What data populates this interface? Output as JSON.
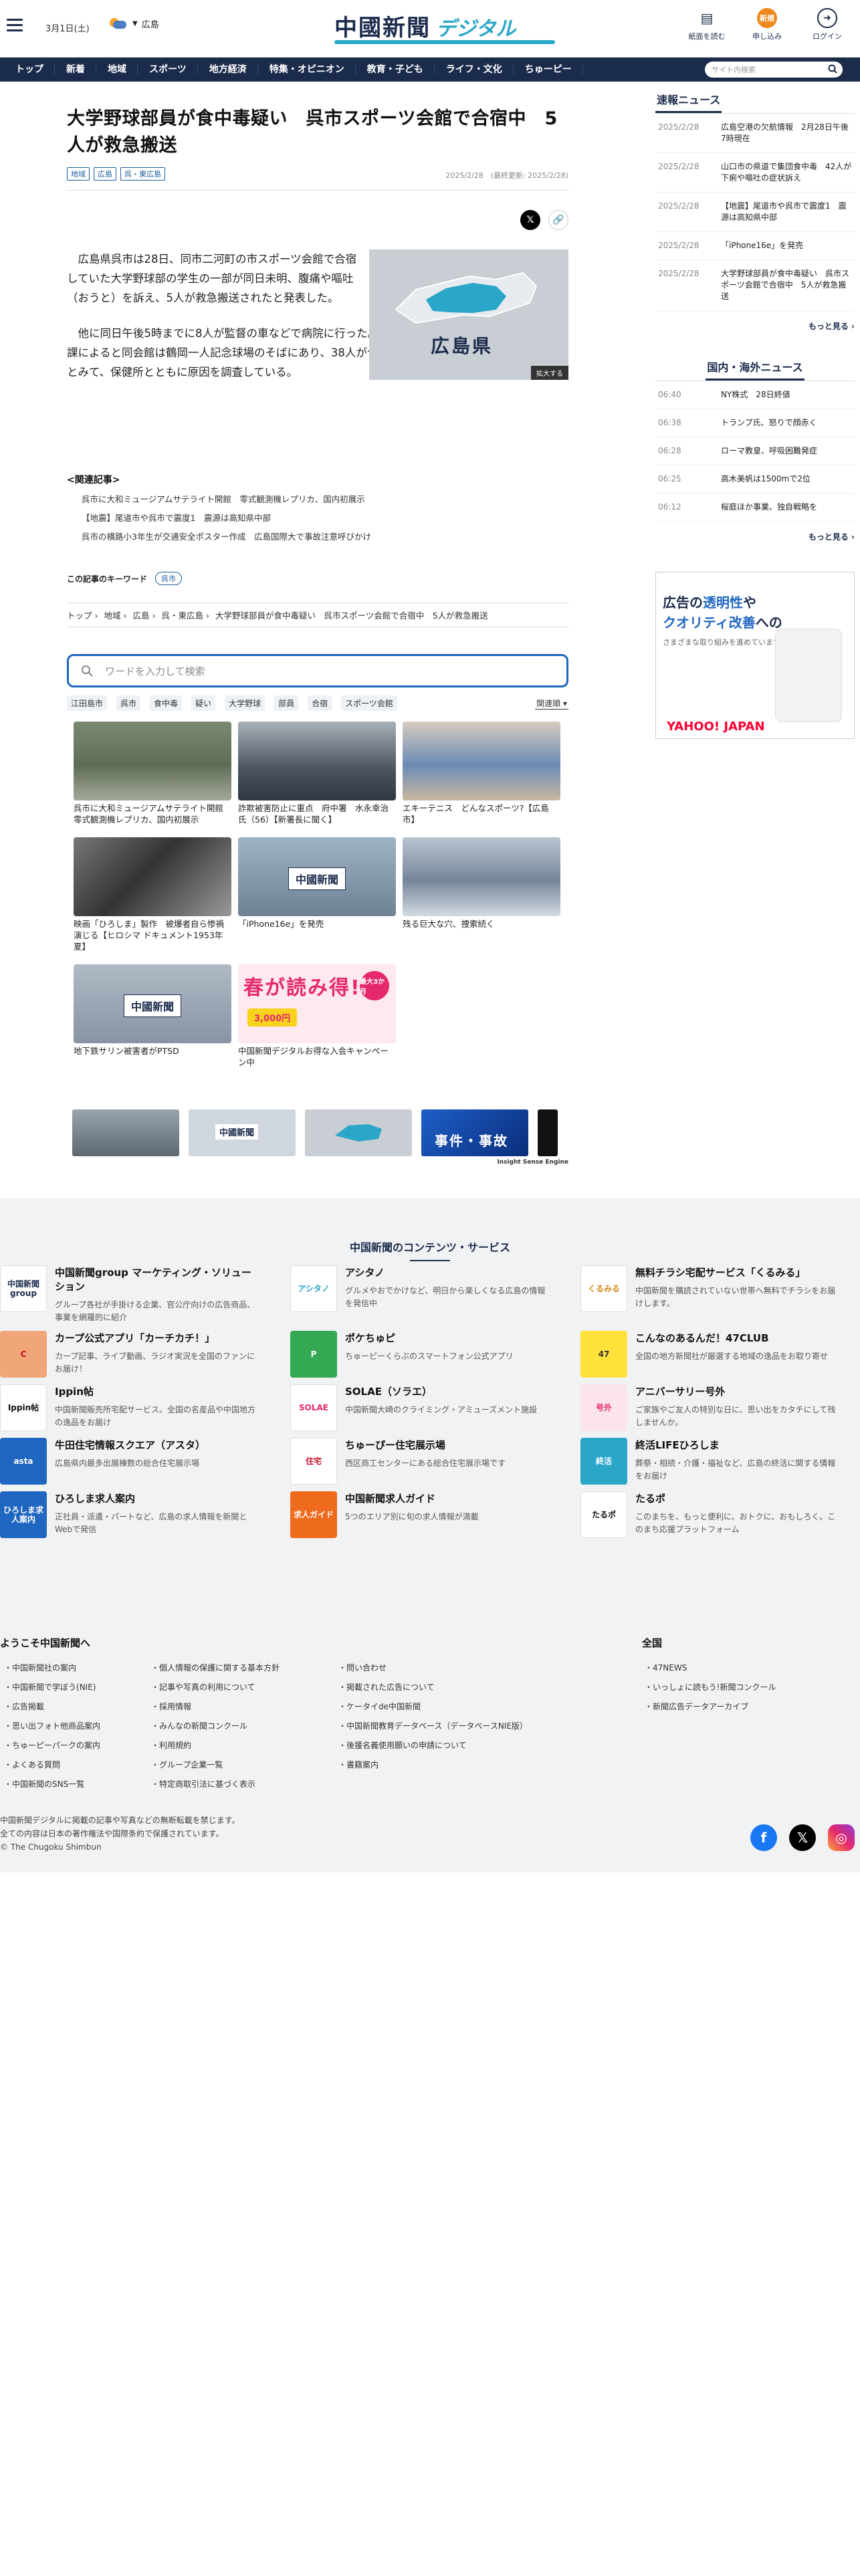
{
  "header": {
    "date": "3月1日(土)",
    "region": "広島",
    "logo_main": "中國新聞",
    "logo_sub": "デジタル",
    "buttons": [
      {
        "label": "紙面を読む"
      },
      {
        "label": "申し込み"
      },
      {
        "label": "ログイン"
      }
    ]
  },
  "nav": {
    "items": [
      "トップ",
      "新着",
      "地域",
      "スポーツ",
      "地方経済",
      "特集・オピニオン",
      "教育・子ども",
      "ライフ・文化",
      "ちゅーピー"
    ],
    "search_placeholder": "サイト内検索"
  },
  "article": {
    "title": "大学野球部員が食中毒疑い　呉市スポーツ会館で合宿中　5人が救急搬送",
    "tags": [
      "地域",
      "広島",
      "呉・東広島"
    ],
    "dates": "2025/2/28　(最終更新: 2025/2/28)",
    "figure_caption": "広島県",
    "zoom_label": "拡大する",
    "p1": "広島県呉市は28日、同市二河町の市スポーツ会館で合宿していた大学野球部の学生の一部が同日未明、腹痛や嘔吐（おうと）を訴え、5人が救急搬送されたと発表した。",
    "p2": "他に同日午後5時までに8人が監督の車などで病院に行った。1人は入院している。市スポーツ振興課によると同会館は鶴岡一人記念球場のそばにあり、38人が合宿していた。市は食中毒の疑いがあるとみて、保健所とともに原因を調査している。"
  },
  "related": {
    "heading": "<関連記事>",
    "items": [
      "呉市に大和ミュージアムサテライト開館　零式観測機レプリカ、国内初展示",
      "【地震】尾道市や呉市で震度1　震源は高知県中部",
      "呉市の横路小3年生が交通安全ポスター作成　広島国際大で事故注意呼びかけ"
    ]
  },
  "keywords": {
    "label": "この記事のキーワード",
    "items": [
      "呉市"
    ]
  },
  "breadcrumb": [
    "トップ",
    "›",
    "地域",
    "›",
    "広島",
    "›",
    "呉・東広島",
    "›",
    "大学野球部員が食中毒疑い　呉市スポーツ会館で合宿中　5人が救急搬送"
  ],
  "search": {
    "placeholder": "ワードを入力して検索",
    "tags": [
      "江田島市",
      "呉市",
      "食中毒",
      "疑い",
      "大学野球",
      "部員",
      "合宿",
      "スポーツ会館"
    ],
    "sort": "関連順"
  },
  "cards": [
    {
      "title": "呉市に大和ミュージアムサテライト開館　零式観測機レプリカ、国内初展示"
    },
    {
      "title": "詐欺被害防止に重点　府中署　水永幸治氏（56）【新署長に聞く】"
    },
    {
      "title": "エキーテニス　どんなスポーツ?【広島市】"
    },
    {
      "title": "映画「ひろしま」製作　被爆者自ら惨禍演じる【ヒロシマ ドキュメント1953年夏】"
    },
    {
      "title": "「iPhone16e」を発売",
      "logo": "中國新聞"
    },
    {
      "title": "残る巨大な穴、捜索続く"
    },
    {
      "title": "地下鉄サリン被害者がPTSD",
      "logo": "中國新聞"
    },
    {
      "title": "中国新聞デジタルお得な入会キャンペーン中",
      "promo": "春が読み得!",
      "promo2": "3,000円",
      "promo3": "最大3か月"
    }
  ],
  "ad_label": "広告",
  "strip": {
    "logo": "中國新聞",
    "banner": "事件・事故",
    "credit": "Insight Sense Engine"
  },
  "sidebar": {
    "flash_title": "速報ニュース",
    "flash": [
      {
        "date": "2025/2/28",
        "title": "広島空港の欠航情報　2月28日午後7時現在"
      },
      {
        "date": "2025/2/28",
        "title": "山口市の県道で集団食中毒　42人が下痢や嘔吐の症状訴え"
      },
      {
        "date": "2025/2/28",
        "title": "【地震】尾道市や呉市で震度1　震源は高知県中部"
      },
      {
        "date": "2025/2/28",
        "title": "「iPhone16e」を発売"
      },
      {
        "date": "2025/2/28",
        "title": "大学野球部員が食中毒疑い　呉市スポーツ会館で合宿中　5人が救急搬送"
      }
    ],
    "more": "もっと見る ›",
    "world_title": "国内・海外ニュース",
    "world": [
      {
        "date": "06:40",
        "title": "NY株式　28日終値"
      },
      {
        "date": "06:38",
        "title": "トランプ氏、怒りで顔赤く"
      },
      {
        "date": "06:28",
        "title": "ローマ教皇、呼吸困難発症"
      },
      {
        "date": "06:25",
        "title": "高木美帆は1500mで2位"
      },
      {
        "date": "06:12",
        "title": "桜庭ほか事業、独自戦略を"
      }
    ],
    "ad_h1": "広告の",
    "ad_h2": "透明性",
    "ad_h3": "や",
    "ad_h4": "クオリティ改善",
    "ad_h5": "への",
    "ad_sub": "さまざまな取り組みを進めています。",
    "ad_brand": "YAHOO! JAPAN"
  },
  "services": {
    "heading": "中国新聞のコンテンツ・サービス",
    "items": [
      {
        "name": "中国新聞group マーケティング・ソリューション",
        "desc": "グループ各社が手掛ける企業、官公庁向けの広告商品、事業を網羅的に紹介",
        "logo": "中国新聞group",
        "color": "#ffffff",
        "fg": "#1b2b4b"
      },
      {
        "name": "アシタノ",
        "desc": "グルメやおでかけなど、明日から楽しくなる広島の情報を発信中",
        "logo": "アシタノ",
        "color": "#ffffff",
        "fg": "#2aa6c9"
      },
      {
        "name": "無料チラシ宅配サービス「くるみる」",
        "desc": "中国新聞を購読されていない世帯へ無料でチラシをお届けします。",
        "logo": "くるみる",
        "color": "#ffffff",
        "fg": "#d28b1b"
      },
      {
        "name": "カープ公式アプリ「カーチカチ！」",
        "desc": "カープ記事、ライブ動画、ラジオ実況を全国のファンにお届け！",
        "logo": "C",
        "color": "#f0a679",
        "fg": "#c8102e"
      },
      {
        "name": "ポケちゅピ",
        "desc": "ちゅーピーくらぶのスマートフォン公式アプリ",
        "logo": "P",
        "color": "#34a853",
        "fg": "#ffffff"
      },
      {
        "name": "こんなのあるんだ！47CLUB",
        "desc": "全国の地方新聞社が厳選する地域の逸品をお取り寄せ",
        "logo": "47",
        "color": "#ffe23a",
        "fg": "#333"
      },
      {
        "name": "Ippin帖",
        "desc": "中国新聞販売所宅配サービス。全国の名産品や中国地方の逸品をお届け",
        "logo": "Ippin帖",
        "color": "#ffffff",
        "fg": "#111"
      },
      {
        "name": "SOLAE（ソラエ）",
        "desc": "中国新聞大崎のクライミング・アミューズメント施設",
        "logo": "SOLAE",
        "color": "#ffffff",
        "fg": "#e6286d"
      },
      {
        "name": "アニバーサリー号外",
        "desc": "ご家族やご友人の特別な日に、思い出をカタチにして残しませんか。",
        "logo": "号外",
        "color": "#fbe4ec",
        "fg": "#e6286d"
      },
      {
        "name": "牛田住宅情報スクエア（アスタ）",
        "desc": "広島県内最多出展棟数の総合住宅展示場",
        "logo": "asta",
        "color": "#1f66c1",
        "fg": "#ffffff"
      },
      {
        "name": "ちゅーぴー住宅展示場",
        "desc": "西区商工センターにある総合住宅展示場です",
        "logo": "住宅",
        "color": "#ffffff",
        "fg": "#c8102e"
      },
      {
        "name": "終活LIFEひろしま",
        "desc": "葬祭・相続・介護・福祉など、広島の終活に関する情報をお届け",
        "logo": "終活",
        "color": "#2aa6c9",
        "fg": "#ffffff"
      },
      {
        "name": "ひろしま求人案内",
        "desc": "正社員・派遣・パートなど、広島の求人情報を新聞とWebで発信",
        "logo": "ひろしま求人案内",
        "color": "#1f66c1",
        "fg": "#ffffff"
      },
      {
        "name": "中国新聞求人ガイド",
        "desc": "5つのエリア別に旬の求人情報が満載",
        "logo": "求人ガイド",
        "color": "#ee6a1d",
        "fg": "#ffffff"
      },
      {
        "name": "たるポ",
        "desc": "このまちを、もっと便利に、おトクに、おもしろく。このまち応援プラットフォーム",
        "logo": "たるポ",
        "color": "#ffffff",
        "fg": "#111"
      }
    ]
  },
  "footer": {
    "welcome_title": "ようこそ中国新聞へ",
    "col1": [
      "中国新聞社の案内",
      "中国新聞で学ぼう(NIE)",
      "広告掲載",
      "思い出フォト他商品案内",
      "ちゅーピーパークの案内",
      "よくある質問",
      "中国新聞のSNS一覧"
    ],
    "col2": [
      "個人情報の保護に関する基本方針",
      "記事や写真の利用について",
      "採用情報",
      "みんなの新聞コンクール",
      "利用規約",
      "グループ企業一覧",
      "特定商取引法に基づく表示"
    ],
    "col3": [
      "問い合わせ",
      "掲載された広告について",
      "ケータイde中国新聞",
      "中国新聞教育データベース（データベースNIE版）",
      "後援名義使用願いの申請について",
      "書籍案内"
    ],
    "national_title": "全国",
    "col4": [
      "47NEWS",
      "いっしょに読もう!新聞コンクール",
      "新聞広告データアーカイブ"
    ],
    "copy1": "中国新聞デジタルに掲載の記事や写真などの無断転載を禁じます。",
    "copy2": "全ての内容は日本の著作権法や国際条約で保護されています。",
    "copy3": "© The Chugoku Shimbun"
  }
}
